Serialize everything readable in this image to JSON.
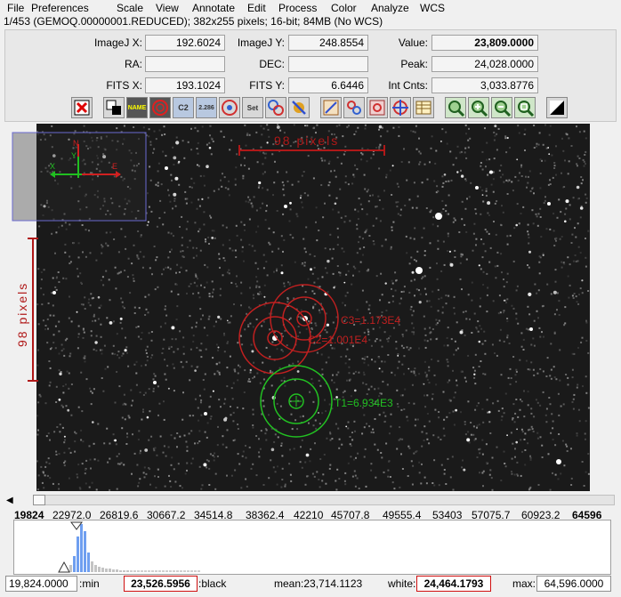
{
  "menu": [
    "File",
    "Preferences",
    "Scale",
    "View",
    "Annotate",
    "Edit",
    "Process",
    "Color",
    "Analyze",
    "WCS"
  ],
  "info_line": "1/453 (GEMOQ.00000001.REDUCED); 382x255 pixels; 16-bit; 84MB (No WCS)",
  "readouts": {
    "imagej_x_label": "ImageJ X:",
    "imagej_x": "192.6024",
    "imagej_y_label": "ImageJ Y:",
    "imagej_y": "248.8554",
    "value_label": "Value:",
    "value": "23,809.0000",
    "ra_label": "RA:",
    "ra": "",
    "dec_label": "DEC:",
    "dec": "",
    "peak_label": "Peak:",
    "peak": "24,028.0000",
    "fits_x_label": "FITS X:",
    "fits_x": "193.1024",
    "fits_y_label": "FITS Y:",
    "fits_y": "6.6446",
    "int_cnts_label": "Int Cnts:",
    "int_cnts": "3,033.8776"
  },
  "toolbar": {
    "name_label": "NAME",
    "c2_label": "C2",
    "c2_286_label": "2.286",
    "set_label": "Set"
  },
  "image": {
    "scale_bar_top": "98 pixels",
    "scale_bar_left": "98 pixels",
    "compass_n": "N",
    "compass_e": "E",
    "compass_y": "Y",
    "compass_x": "X",
    "label_c3": "C3=1.173E4",
    "label_c2": "C2=1.001E4",
    "label_t1": "T1=6.934E3"
  },
  "colors": {
    "aperture_red": "#b01818",
    "aperture_green": "#22c022",
    "histogram_blue": "#6f9ff0",
    "stat_box_border": "#d01010"
  },
  "histogram_ticks": [
    "19824",
    "22972.0",
    "26819.6",
    "30667.2",
    "34514.8",
    "38362.4",
    "42210",
    "45707.8",
    "49555.4",
    "53403",
    "57075.7",
    "60923.2",
    "64596"
  ],
  "bottom": {
    "min_value": "19,824.0000",
    "min_label": ":min",
    "black_value": "23,526.5956",
    "black_label": ":black",
    "mean_text": "mean:23,714.1123",
    "white_label": "white:",
    "white_value": "24,464.1793",
    "max_label": "max:",
    "max_value": "64,596.0000"
  }
}
